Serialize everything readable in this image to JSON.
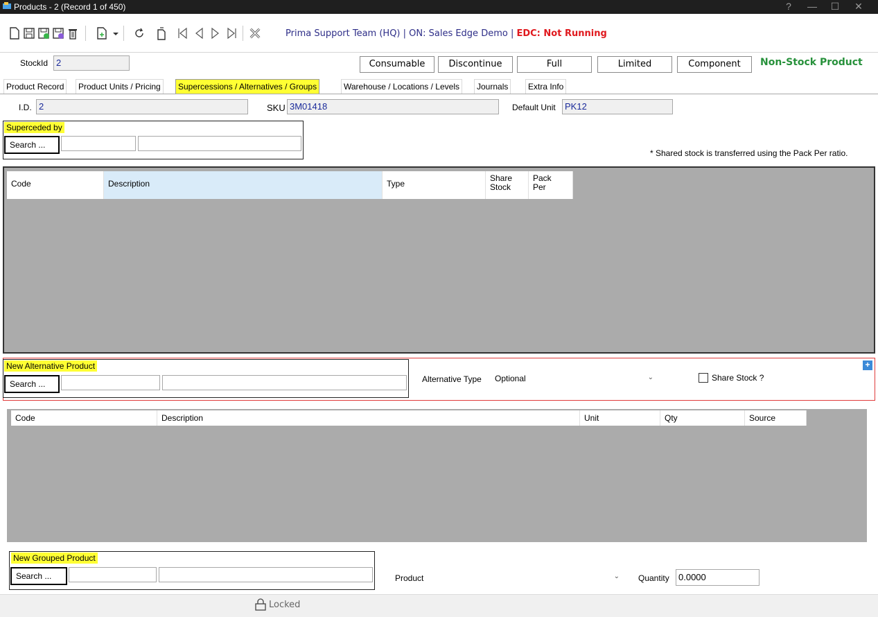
{
  "window": {
    "title": "Products - 2  (Record 1 of 450)",
    "controls": {
      "help": "?",
      "minimize": "—",
      "maximize": "☐",
      "close": "✕"
    }
  },
  "toolbar": {
    "icons": [
      "new-icon",
      "save-icon",
      "save-new-icon",
      "save-close-icon",
      "delete-icon",
      "add-icon",
      "dropdown-icon",
      "refresh-icon",
      "copy-icon",
      "first-record-icon",
      "previous-record-icon",
      "next-record-icon",
      "last-record-icon",
      "close-icon"
    ],
    "status_prefix": "Prima Support Team (HQ) | ON: Sales Edge Demo | ",
    "status_edc": "EDC: Not Running"
  },
  "header": {
    "stock_id_label": "StockId",
    "stock_id_value": "2",
    "type_buttons": [
      "Consumable",
      "Discontinue",
      "Full",
      "Limited",
      "Component"
    ],
    "product_type": "Non-Stock Product"
  },
  "tabs": [
    "Product Record",
    "Product Units / Pricing",
    "Supercessions / Alternatives / Groups",
    "Warehouse / Locations / Levels",
    "Journals",
    "Extra Info"
  ],
  "active_tab": "Supercessions / Alternatives / Groups",
  "record": {
    "id_label": "I.D.",
    "id_value": "2",
    "sku_label": "SKU",
    "sku_value": "3M01418",
    "unit_label": "Default Unit",
    "unit_value": "PK12"
  },
  "superceded": {
    "title": "Superceded by",
    "search_label": "Search ...",
    "note": "* Shared stock is transferred using the Pack Per ratio."
  },
  "alternatives_grid": {
    "columns": [
      "Code",
      "Description",
      "Type",
      "Share Stock",
      "Pack Per"
    ]
  },
  "new_alternative": {
    "title": "New Alternative Product",
    "search_label": "Search ...",
    "type_label": "Alternative Type",
    "type_value": "Optional",
    "share_stock_label": "Share Stock ?",
    "share_stock_checked": false,
    "add_button": "+"
  },
  "groups_grid": {
    "columns": [
      "Code",
      "Description",
      "Unit",
      "Qty",
      "Source"
    ]
  },
  "new_grouped": {
    "title": "New Grouped Product",
    "search_label": "Search ...",
    "product_label": "Product",
    "product_value": "",
    "quantity_label": "Quantity",
    "quantity_value": "0.0000"
  },
  "footer": {
    "lock_status": "Locked"
  },
  "colors": {
    "highlight": "#ffff33",
    "edc_status": "#e0191e",
    "product_type": "#27913b",
    "grid_background": "#ababab",
    "selected_header": "#d9ebf9"
  }
}
